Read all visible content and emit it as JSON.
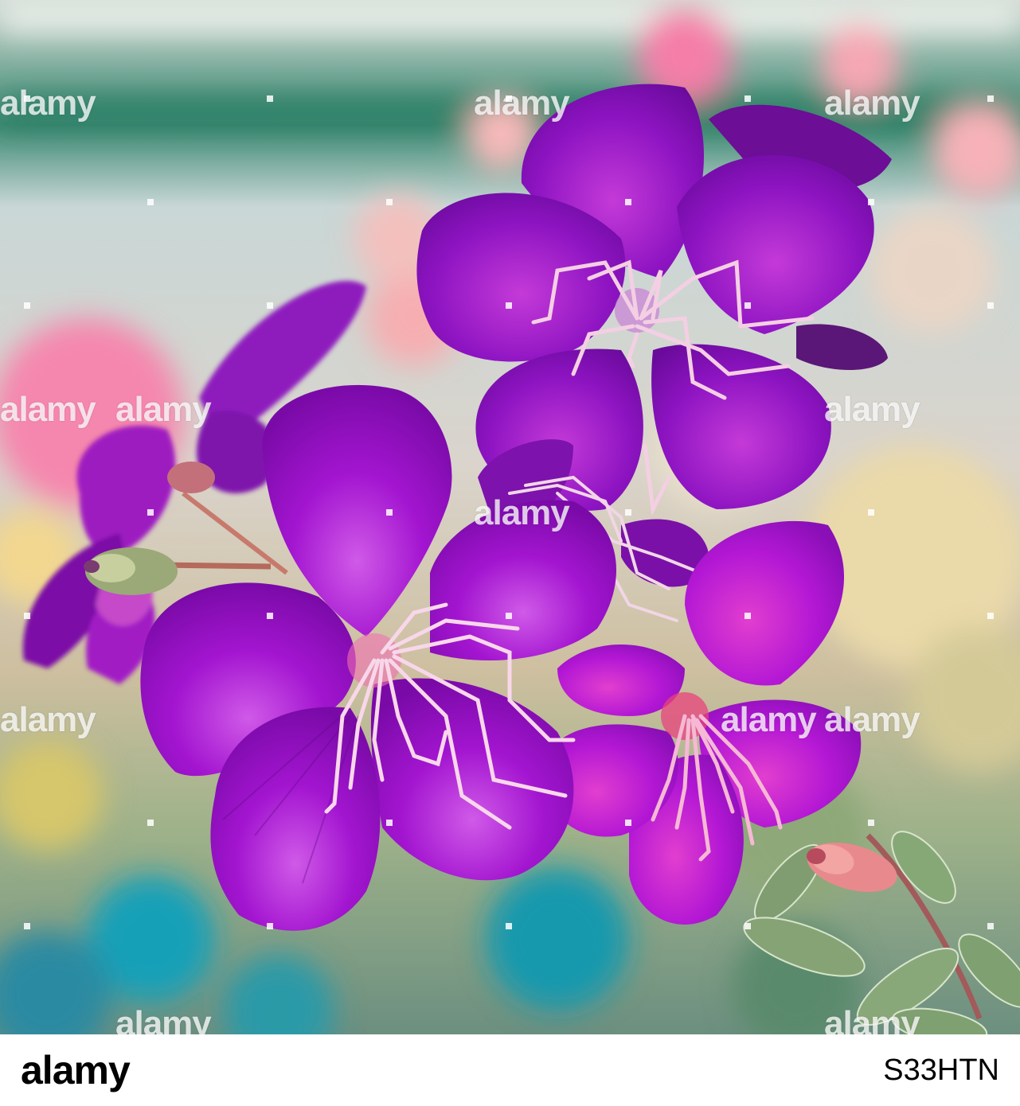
{
  "watermark": {
    "text": "alamy"
  },
  "footer": {
    "logo_text": "alamy",
    "image_id": "S33HTN"
  },
  "colors": {
    "petal_purple": "#8a10b8",
    "petal_magenta": "#b41ad6",
    "stamen_pink": "#f3c6e0",
    "leaf_green": "#7fa070",
    "bokeh_pink": "#f59ab0"
  }
}
